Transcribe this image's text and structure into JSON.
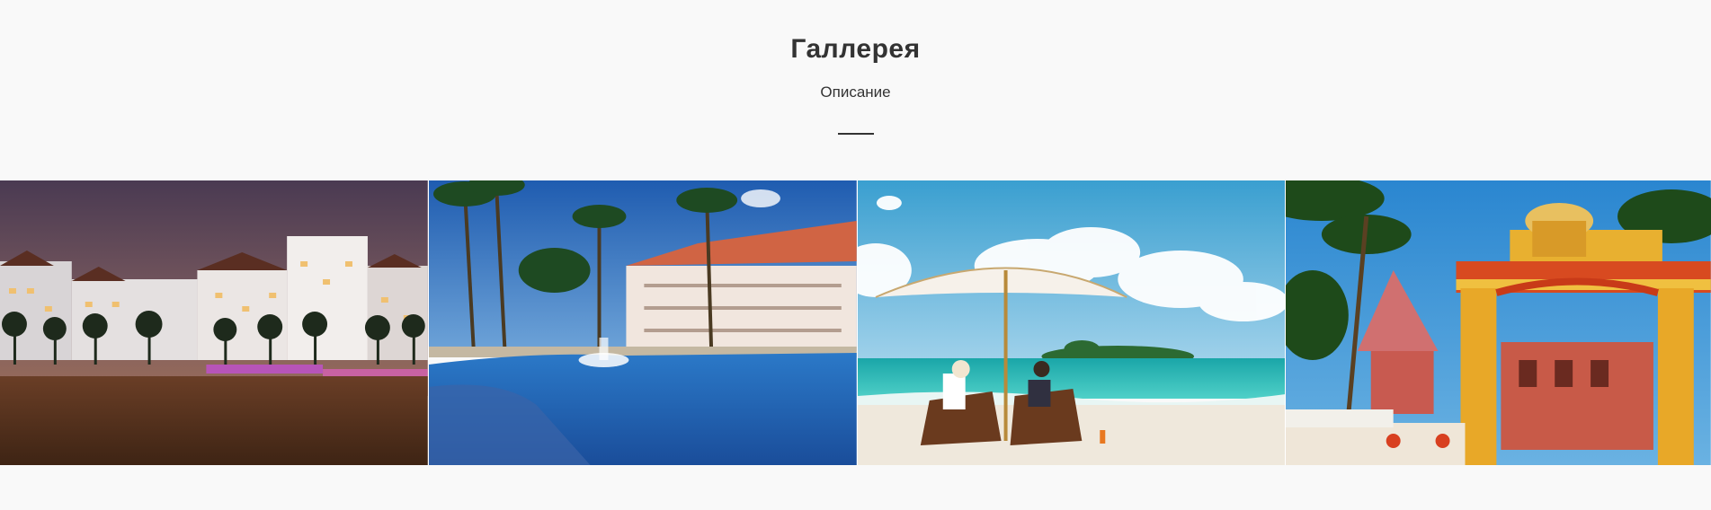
{
  "gallery": {
    "title": "Галлерея",
    "subtitle": "Описание"
  },
  "colors": {
    "background": "#f9f9f9",
    "text": "#333333"
  },
  "images": [
    {
      "id": "night-hotel",
      "icon": "night-resort-photo"
    },
    {
      "id": "pool-resort",
      "icon": "pool-resort-photo"
    },
    {
      "id": "beach-umbrella",
      "icon": "beach-umbrella-photo"
    },
    {
      "id": "temple-gate",
      "icon": "temple-gate-photo"
    }
  ]
}
